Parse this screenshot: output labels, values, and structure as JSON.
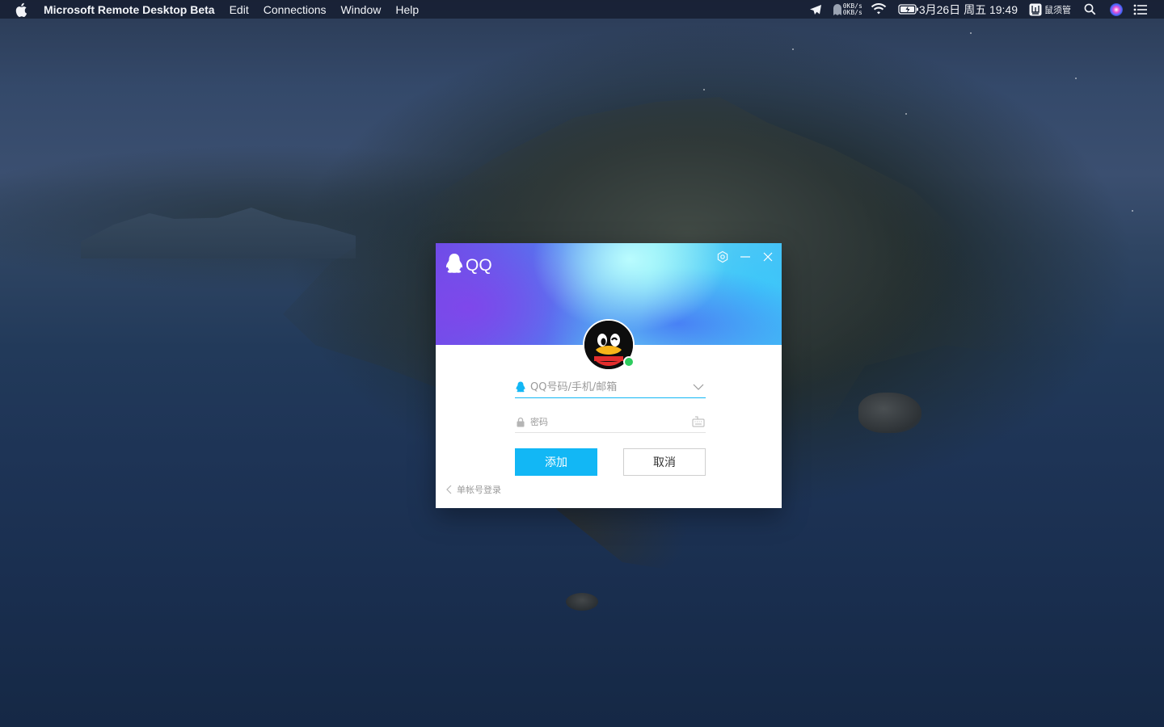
{
  "menubar": {
    "app_name": "Microsoft Remote Desktop Beta",
    "items": [
      "Edit",
      "Connections",
      "Window",
      "Help"
    ],
    "netspeed_up": "0KB/s",
    "netspeed_down": "0KB/s",
    "clock": "3月26日 周五  19:49",
    "app_indicator_label": "鼠须管",
    "icons": [
      "apple-icon",
      "telegram-icon",
      "ghost-icon",
      "wifi-icon",
      "battery-icon",
      "input-method-icon",
      "spotlight-search-icon",
      "siri-icon",
      "notification-center-icon"
    ]
  },
  "qq_window": {
    "logo_text": "QQ",
    "controls": [
      "settings-icon",
      "minimize-icon",
      "close-icon"
    ],
    "account_placeholder": "QQ号码/手机/邮箱",
    "password_placeholder": "密码",
    "add_button": "添加",
    "cancel_button": "取消",
    "back_link": "单帐号登录",
    "accent_color": "#12b7f5",
    "online_status_color": "#2ecc5f"
  }
}
